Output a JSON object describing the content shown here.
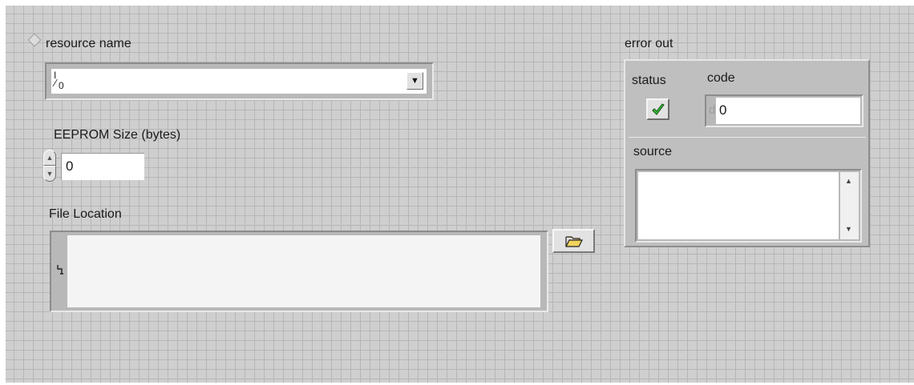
{
  "resource": {
    "label": "resource name",
    "value": "",
    "io_glyph_top": "I",
    "io_glyph_bottom": "0",
    "dropdown_icon": "triangle-down"
  },
  "eeprom": {
    "label": "EEPROM Size (bytes)",
    "value": "0",
    "increment_icon": "arrow-up",
    "decrement_icon": "arrow-down"
  },
  "file": {
    "label": "File Location",
    "value": "",
    "path_icon": "path-glyph",
    "browse_icon": "folder-open"
  },
  "error_out": {
    "label": "error out",
    "status_label": "status",
    "status_icon": "check-mark",
    "status_color": "#38c838",
    "code_label": "code",
    "code_prefix": "d",
    "code_value": "0",
    "source_label": "source",
    "source_value": ""
  }
}
